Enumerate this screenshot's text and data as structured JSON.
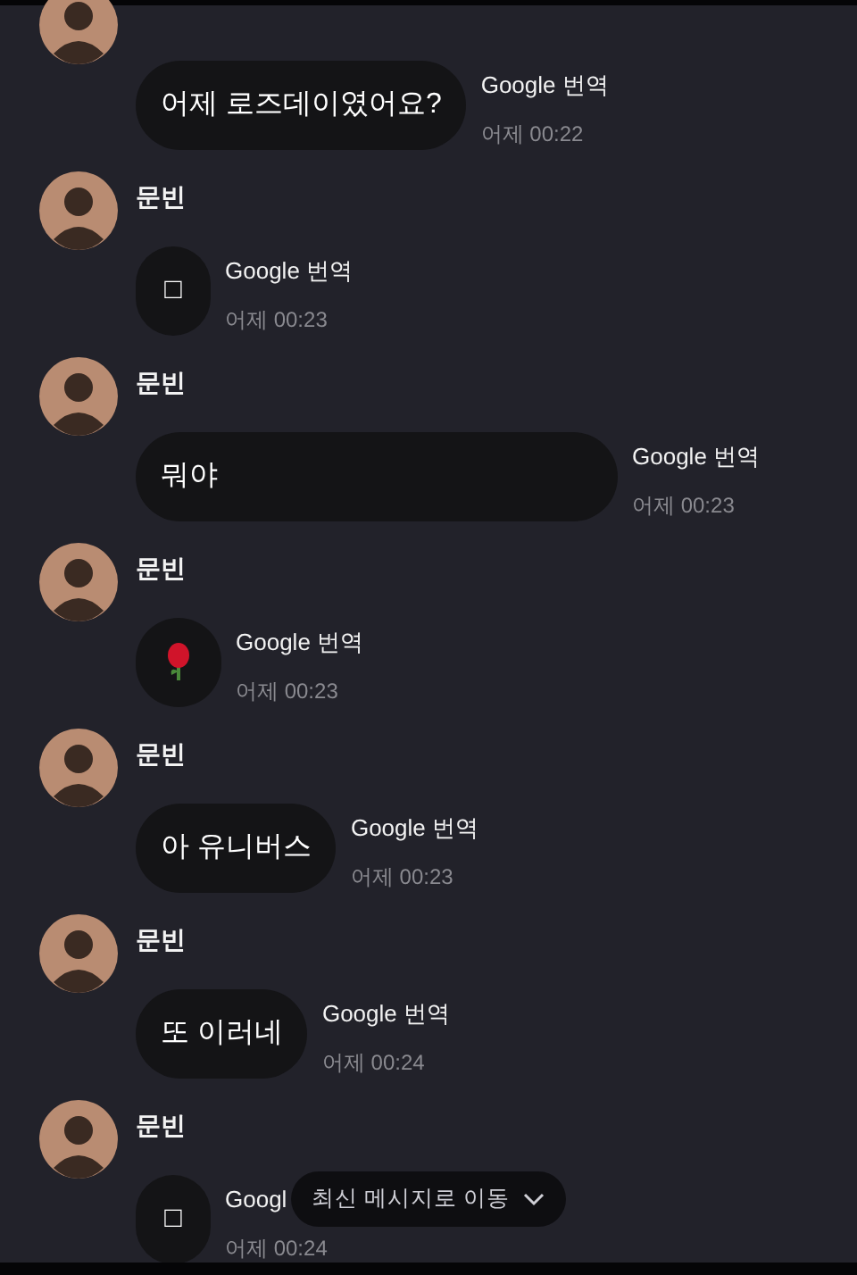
{
  "messages": [
    {
      "kind": "text",
      "body": "어제 로즈데이였어요?",
      "translate": "Google 번역",
      "time": "어제 00:22"
    },
    {
      "sender": "문빈",
      "kind": "text",
      "body": "□",
      "translate": "Google 번역",
      "time": "어제 00:23"
    },
    {
      "sender": "문빈",
      "kind": "text",
      "body": "뭐야",
      "translate": "Google 번역",
      "time": "어제 00:23",
      "wide": true
    },
    {
      "sender": "문빈",
      "kind": "rose",
      "translate": "Google 번역",
      "time": "어제 00:23"
    },
    {
      "sender": "문빈",
      "kind": "text",
      "body": "아 유니버스",
      "translate": "Google 번역",
      "time": "어제 00:23"
    },
    {
      "sender": "문빈",
      "kind": "text",
      "body": "또 이러네",
      "translate": "Google 번역",
      "time": "어제 00:24"
    },
    {
      "sender": "문빈",
      "kind": "text",
      "body": "□",
      "translate": "Googl",
      "time": "어제 00:24"
    }
  ],
  "jump_button": {
    "label": "최신 메시지로 이동"
  }
}
